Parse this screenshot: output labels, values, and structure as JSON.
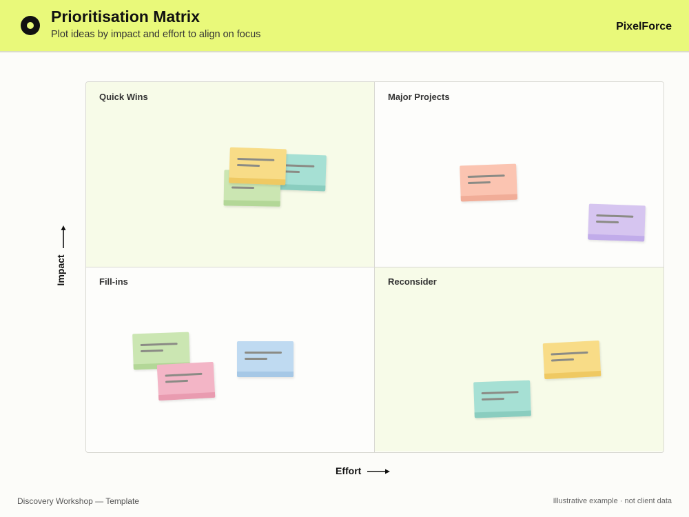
{
  "header": {
    "title": "Prioritisation Matrix",
    "subtitle": "Plot ideas by impact and effort to align on focus",
    "brand": "PixelForce",
    "accent_color": "#e9f97a"
  },
  "matrix": {
    "quadrants": [
      {
        "label": "Quick Wins",
        "notes": [
          "teal",
          "green",
          "yellow"
        ]
      },
      {
        "label": "Major Projects",
        "notes": [
          "salmon",
          "lavender"
        ]
      },
      {
        "label": "Fill-ins",
        "notes": [
          "green",
          "pink",
          "blue"
        ]
      },
      {
        "label": "Reconsider",
        "notes": [
          "yellow",
          "teal"
        ]
      }
    ],
    "axes": {
      "y_label": "Impact",
      "x_label": "Effort"
    }
  },
  "footer": {
    "left": "Discovery Workshop — Template",
    "right": "Illustrative example · not client data"
  }
}
